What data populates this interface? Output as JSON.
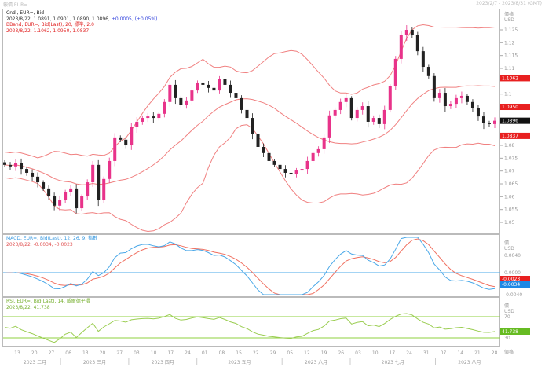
{
  "window": {
    "title": "報價 EUR=",
    "range": "2023/2/7 - 2023/8/31 (GMT)"
  },
  "main": {
    "legend": {
      "candle": "Cndl, EUR=, Bid",
      "ohlc": "2023/8/22, 1.0891, 1.0901, 1.0890, 1.0896,",
      "change": "+0.0005, (+0.05%)",
      "bband": "BBand, EUR=, Bid(Last), 20, 標準, 2.0",
      "bband_values": "2023/8/22, 1.1062, 1.0950, 1.0837"
    },
    "axis_header": [
      "價格",
      "USD"
    ],
    "tags": {
      "upper": "1.1062",
      "mid": "1.0950",
      "last": "1.0896",
      "lower": "1.0837"
    }
  },
  "macd": {
    "legend": "MACD, EUR=, Bid(Last), 12, 26, 9, 指數",
    "values": "2023/8/22, -0.0034, -0.0023",
    "axis_header": [
      "價",
      "USD"
    ],
    "tags": {
      "signal": "-0.0023",
      "macd": "-0.0034"
    }
  },
  "rsi": {
    "legend": "RSI, EUR=, Bid(Last), 14, 威爾德平滑",
    "values": "2023/8/22, 41.738",
    "axis_header": [
      "價",
      "USD"
    ],
    "tag": "41.738"
  },
  "colors": {
    "up": "#e8338a",
    "down": "#222222",
    "band": "#f08080",
    "macd": "#4aa8e8",
    "signal": "#f07060",
    "rsi": "#9acd50",
    "rsi_level": "#8fd13f",
    "tag_red": "#e82020",
    "tag_blue": "#1e88e5",
    "tag_green": "#66bb22"
  },
  "chart_data": [
    {
      "type": "candlestick",
      "series": "EUR=",
      "ylim": [
        1.05,
        1.127
      ],
      "yticks": [
        1.125,
        1.12,
        1.115,
        1.11,
        1.1,
        1.08,
        1.075,
        1.07,
        1.065,
        1.06,
        1.055,
        1.05
      ],
      "ytick_labels": [
        "1.125",
        "1.12",
        "1.115",
        "1.11",
        "1.1",
        "1.08",
        "1.075",
        "1.07",
        "1.065",
        "1.06",
        "1.055",
        "1.05"
      ],
      "close": [
        1.0724,
        1.0718,
        1.073,
        1.0708,
        1.0693,
        1.0678,
        1.0656,
        1.0632,
        1.0601,
        1.0565,
        1.0586,
        1.0617,
        1.0632,
        1.0555,
        1.0601,
        1.0656,
        1.0724,
        1.0586,
        1.0669,
        1.0739,
        1.0831,
        1.0822,
        1.08,
        1.0871,
        1.0892,
        1.0907,
        1.0913,
        1.0907,
        1.0923,
        1.0969,
        1.1036,
        1.0984,
        1.0959,
        1.0975,
        1.1014,
        1.1045,
        1.1036,
        1.1024,
        1.1014,
        1.106,
        1.1036,
        1.1005,
        1.0984,
        1.0938,
        1.0907,
        1.0846,
        1.0794,
        1.077,
        1.0739,
        1.0724,
        1.0708,
        1.0693,
        1.0687,
        1.0702,
        1.0708,
        1.0739,
        1.077,
        1.0785,
        1.0831,
        1.0917,
        1.0938,
        1.0969,
        1.0984,
        1.0907,
        1.0938,
        1.0953,
        1.0892,
        1.0907,
        1.0883,
        1.0938,
        1.103,
        1.1137,
        1.1229,
        1.125,
        1.1229,
        1.1167,
        1.1106,
        1.107,
        1.0984,
        1.1005,
        1.0953,
        1.0962,
        1.0984,
        1.0993,
        1.0969,
        1.0944,
        1.0913,
        1.0886,
        1.0883,
        1.0896
      ],
      "bollinger": {
        "period": 20,
        "stdev": 2.0
      }
    },
    {
      "type": "line",
      "indicator": "MACD",
      "params": [
        12,
        26,
        9
      ],
      "yticks": [
        "0.0040",
        "0.0000",
        "-0.0040"
      ],
      "last": {
        "macd": -0.0034,
        "signal": -0.0023
      }
    },
    {
      "type": "line",
      "indicator": "RSI",
      "period": 14,
      "levels": [
        70,
        30
      ],
      "ytick_labels": [
        "70",
        "30"
      ],
      "last": 41.738
    }
  ],
  "xaxis": {
    "days": [
      "13",
      "20",
      "27",
      "06",
      "13",
      "20",
      "27",
      "03",
      "10",
      "17",
      "24",
      "01",
      "08",
      "15",
      "22",
      "29",
      "05",
      "12",
      "19",
      "26",
      "03",
      "10",
      "17",
      "24",
      "31",
      "07",
      "14",
      "21",
      "28"
    ],
    "months": [
      "2023 二月",
      "2023 三月",
      "2023 四月",
      "2023 五月",
      "2023 六月",
      "2023 七月",
      "2023 八月"
    ],
    "corner": "價格"
  }
}
